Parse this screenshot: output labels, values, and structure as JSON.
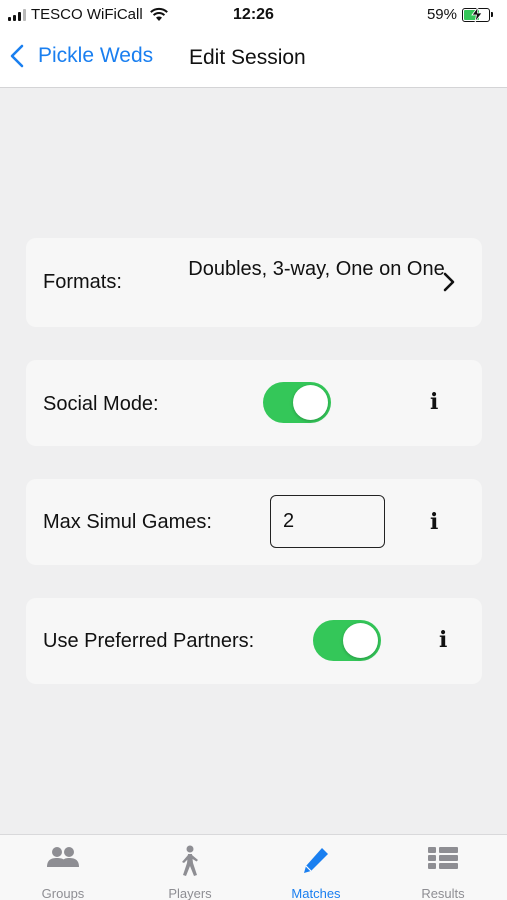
{
  "status_bar": {
    "carrier": "TESCO WiFiCall",
    "time": "12:26",
    "battery": "59%",
    "battery_level": 0.59
  },
  "nav": {
    "back_label": "Pickle Weds",
    "title": "Edit Session"
  },
  "settings": {
    "formats_label": "Formats:",
    "formats_value": "Doubles, 3-way, One on One",
    "social_mode_label": "Social Mode:",
    "social_mode_on": true,
    "max_simul_label": "Max Simul Games:",
    "max_simul_value": "2",
    "preferred_partners_label": "Use Preferred Partners:",
    "preferred_partners_on": true,
    "info_glyph": "i"
  },
  "tabs": [
    {
      "label": "Groups",
      "icon": "groups-icon",
      "active": false
    },
    {
      "label": "Players",
      "icon": "players-icon",
      "active": false
    },
    {
      "label": "Matches",
      "icon": "matches-icon",
      "active": true
    },
    {
      "label": "Results",
      "icon": "results-icon",
      "active": false
    }
  ],
  "colors": {
    "accent": "#1a7ff0",
    "toggle_on": "#34c759",
    "tab_inactive": "#8e8e93"
  }
}
